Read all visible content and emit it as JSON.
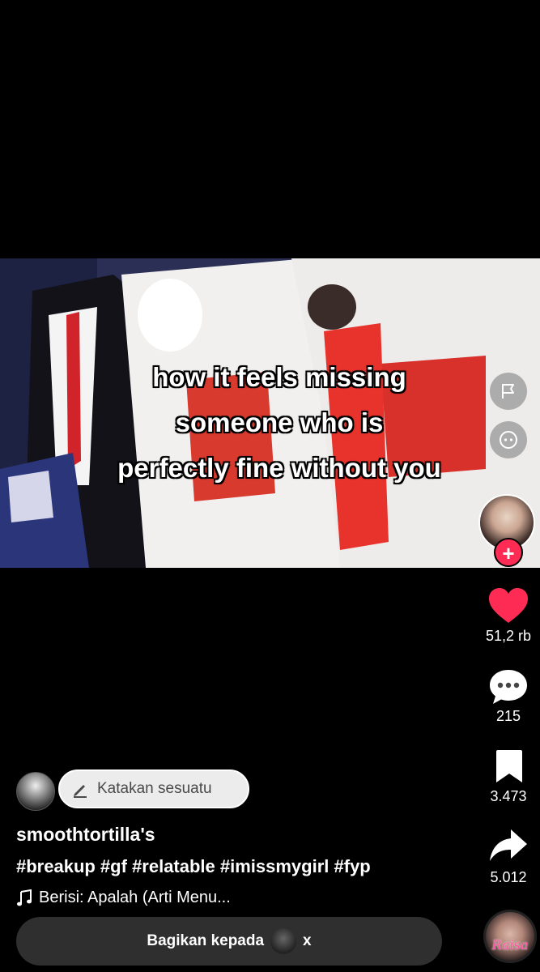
{
  "video": {
    "caption": "how it feels missing\nsomeone who is\nperfectly fine without you"
  },
  "actions": {
    "like_count": "51,2 rb",
    "comment_count": "215",
    "bookmark_count": "3.473",
    "share_count": "5.012",
    "follow_symbol": "+",
    "music_disc_text": "Raisa"
  },
  "post": {
    "comment_prompt": "Katakan sesuatu",
    "username": "smoothtortilla's",
    "hashtags": "#breakup #gf #relatable #imissmygirl #fyp",
    "music": "Berisi: Apalah (Arti Menu...",
    "share_label": "Bagikan kepada",
    "share_close": "x"
  },
  "colors": {
    "like": "#fe2c55",
    "follow": "#fe2c55",
    "background": "#000000"
  },
  "icons": [
    "flag-icon",
    "face-icon",
    "heart-icon",
    "comment-icon",
    "bookmark-icon",
    "share-arrow-icon",
    "music-note-icon",
    "pencil-icon"
  ]
}
